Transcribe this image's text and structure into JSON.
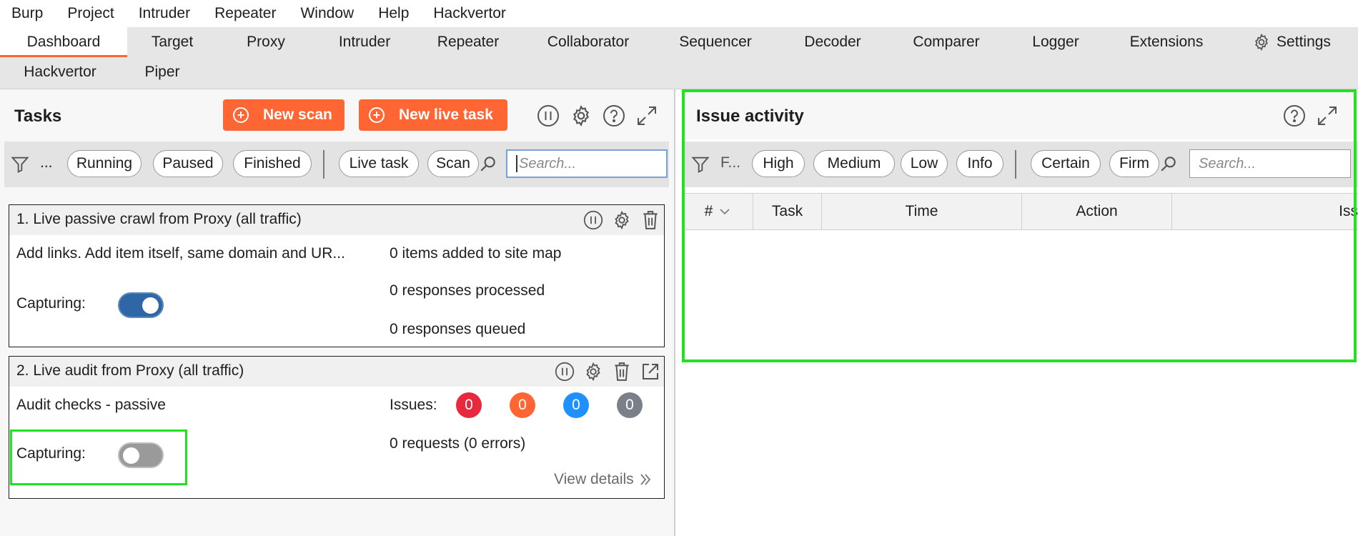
{
  "menu": [
    "Burp",
    "Project",
    "Intruder",
    "Repeater",
    "Window",
    "Help",
    "Hackvertor"
  ],
  "tabs": {
    "row1": [
      "Dashboard",
      "Target",
      "Proxy",
      "Intruder",
      "Repeater",
      "Collaborator",
      "Sequencer",
      "Decoder",
      "Comparer",
      "Logger",
      "Extensions",
      "Settings"
    ],
    "row2": [
      "Hackvertor",
      "Piper"
    ],
    "active": "Dashboard"
  },
  "tasks": {
    "title": "Tasks",
    "new_scan": "New scan",
    "new_live_task": "New live task",
    "filter_ellipsis": "...",
    "filters": [
      "Running",
      "Paused",
      "Finished",
      "Live task",
      "Scan"
    ],
    "search_placeholder": "Search...",
    "items": [
      {
        "title": "1.  Live passive crawl from Proxy (all traffic)",
        "description": "Add links. Add item itself, same domain and UR...",
        "capturing_label": "Capturing:",
        "capturing": true,
        "stats": [
          "0 items added to site map",
          "0 responses processed",
          "0 responses queued"
        ]
      },
      {
        "title": "2.  Live audit from Proxy (all traffic)",
        "description": "Audit checks - passive",
        "capturing_label": "Capturing:",
        "capturing": false,
        "issues_label": "Issues:",
        "issue_counts": [
          "0",
          "0",
          "0",
          "0"
        ],
        "issue_colors": [
          "#e8283c",
          "#ff6633",
          "#1e90ff",
          "#7a8088"
        ],
        "requests": "0 requests (0 errors)",
        "view_details": "View details"
      }
    ]
  },
  "issues": {
    "title": "Issue activity",
    "filter_ellipsis": "F...",
    "filters": [
      "High",
      "Medium",
      "Low",
      "Info",
      "Certain",
      "Firm"
    ],
    "search_placeholder": "Search...",
    "columns": [
      "#",
      "Task",
      "Time",
      "Action",
      "Iss"
    ]
  },
  "colors": {
    "accent": "#ff6633",
    "toggle_on": "#2f67a6",
    "highlight": "#22e022"
  }
}
